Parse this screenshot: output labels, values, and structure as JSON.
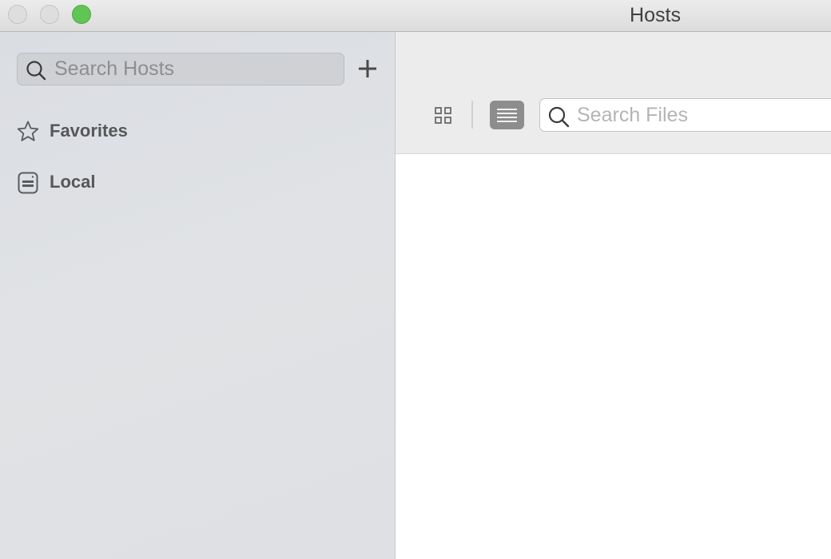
{
  "window": {
    "title": "Hosts",
    "colors": {
      "zoom_button": "#61c554",
      "sidebar_background": "#dfe0e3",
      "toolbar_background": "#ececec",
      "list_view_active": "#8d8d8d"
    }
  },
  "sidebar": {
    "search": {
      "placeholder": "Search Hosts",
      "value": "",
      "icon": "search-icon"
    },
    "add_button": {
      "icon": "plus-icon"
    },
    "items": [
      {
        "label": "Favorites",
        "icon": "star-icon"
      },
      {
        "label": "Local",
        "icon": "drive-icon"
      }
    ]
  },
  "toolbar": {
    "view_modes": [
      {
        "mode": "grid",
        "icon": "grid-icon",
        "active": false
      },
      {
        "mode": "list",
        "icon": "list-icon",
        "active": true
      }
    ],
    "search": {
      "placeholder": "Search Files",
      "value": "",
      "icon": "search-icon"
    }
  }
}
